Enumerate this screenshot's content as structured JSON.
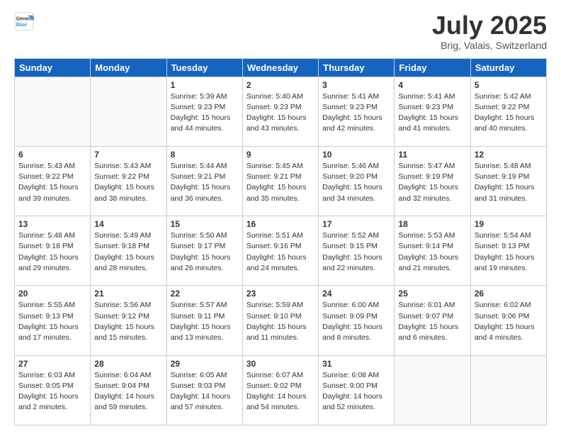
{
  "logo": {
    "general": "General",
    "blue": "Blue"
  },
  "header": {
    "title": "July 2025",
    "location": "Brig, Valais, Switzerland"
  },
  "weekdays": [
    "Sunday",
    "Monday",
    "Tuesday",
    "Wednesday",
    "Thursday",
    "Friday",
    "Saturday"
  ],
  "weeks": [
    [
      {
        "day": "",
        "sunrise": "",
        "sunset": "",
        "daylight": ""
      },
      {
        "day": "",
        "sunrise": "",
        "sunset": "",
        "daylight": ""
      },
      {
        "day": "1",
        "sunrise": "Sunrise: 5:39 AM",
        "sunset": "Sunset: 9:23 PM",
        "daylight": "Daylight: 15 hours and 44 minutes."
      },
      {
        "day": "2",
        "sunrise": "Sunrise: 5:40 AM",
        "sunset": "Sunset: 9:23 PM",
        "daylight": "Daylight: 15 hours and 43 minutes."
      },
      {
        "day": "3",
        "sunrise": "Sunrise: 5:41 AM",
        "sunset": "Sunset: 9:23 PM",
        "daylight": "Daylight: 15 hours and 42 minutes."
      },
      {
        "day": "4",
        "sunrise": "Sunrise: 5:41 AM",
        "sunset": "Sunset: 9:23 PM",
        "daylight": "Daylight: 15 hours and 41 minutes."
      },
      {
        "day": "5",
        "sunrise": "Sunrise: 5:42 AM",
        "sunset": "Sunset: 9:22 PM",
        "daylight": "Daylight: 15 hours and 40 minutes."
      }
    ],
    [
      {
        "day": "6",
        "sunrise": "Sunrise: 5:43 AM",
        "sunset": "Sunset: 9:22 PM",
        "daylight": "Daylight: 15 hours and 39 minutes."
      },
      {
        "day": "7",
        "sunrise": "Sunrise: 5:43 AM",
        "sunset": "Sunset: 9:22 PM",
        "daylight": "Daylight: 15 hours and 38 minutes."
      },
      {
        "day": "8",
        "sunrise": "Sunrise: 5:44 AM",
        "sunset": "Sunset: 9:21 PM",
        "daylight": "Daylight: 15 hours and 36 minutes."
      },
      {
        "day": "9",
        "sunrise": "Sunrise: 5:45 AM",
        "sunset": "Sunset: 9:21 PM",
        "daylight": "Daylight: 15 hours and 35 minutes."
      },
      {
        "day": "10",
        "sunrise": "Sunrise: 5:46 AM",
        "sunset": "Sunset: 9:20 PM",
        "daylight": "Daylight: 15 hours and 34 minutes."
      },
      {
        "day": "11",
        "sunrise": "Sunrise: 5:47 AM",
        "sunset": "Sunset: 9:19 PM",
        "daylight": "Daylight: 15 hours and 32 minutes."
      },
      {
        "day": "12",
        "sunrise": "Sunrise: 5:48 AM",
        "sunset": "Sunset: 9:19 PM",
        "daylight": "Daylight: 15 hours and 31 minutes."
      }
    ],
    [
      {
        "day": "13",
        "sunrise": "Sunrise: 5:48 AM",
        "sunset": "Sunset: 9:18 PM",
        "daylight": "Daylight: 15 hours and 29 minutes."
      },
      {
        "day": "14",
        "sunrise": "Sunrise: 5:49 AM",
        "sunset": "Sunset: 9:18 PM",
        "daylight": "Daylight: 15 hours and 28 minutes."
      },
      {
        "day": "15",
        "sunrise": "Sunrise: 5:50 AM",
        "sunset": "Sunset: 9:17 PM",
        "daylight": "Daylight: 15 hours and 26 minutes."
      },
      {
        "day": "16",
        "sunrise": "Sunrise: 5:51 AM",
        "sunset": "Sunset: 9:16 PM",
        "daylight": "Daylight: 15 hours and 24 minutes."
      },
      {
        "day": "17",
        "sunrise": "Sunrise: 5:52 AM",
        "sunset": "Sunset: 9:15 PM",
        "daylight": "Daylight: 15 hours and 22 minutes."
      },
      {
        "day": "18",
        "sunrise": "Sunrise: 5:53 AM",
        "sunset": "Sunset: 9:14 PM",
        "daylight": "Daylight: 15 hours and 21 minutes."
      },
      {
        "day": "19",
        "sunrise": "Sunrise: 5:54 AM",
        "sunset": "Sunset: 9:13 PM",
        "daylight": "Daylight: 15 hours and 19 minutes."
      }
    ],
    [
      {
        "day": "20",
        "sunrise": "Sunrise: 5:55 AM",
        "sunset": "Sunset: 9:13 PM",
        "daylight": "Daylight: 15 hours and 17 minutes."
      },
      {
        "day": "21",
        "sunrise": "Sunrise: 5:56 AM",
        "sunset": "Sunset: 9:12 PM",
        "daylight": "Daylight: 15 hours and 15 minutes."
      },
      {
        "day": "22",
        "sunrise": "Sunrise: 5:57 AM",
        "sunset": "Sunset: 9:11 PM",
        "daylight": "Daylight: 15 hours and 13 minutes."
      },
      {
        "day": "23",
        "sunrise": "Sunrise: 5:59 AM",
        "sunset": "Sunset: 9:10 PM",
        "daylight": "Daylight: 15 hours and 11 minutes."
      },
      {
        "day": "24",
        "sunrise": "Sunrise: 6:00 AM",
        "sunset": "Sunset: 9:09 PM",
        "daylight": "Daylight: 15 hours and 8 minutes."
      },
      {
        "day": "25",
        "sunrise": "Sunrise: 6:01 AM",
        "sunset": "Sunset: 9:07 PM",
        "daylight": "Daylight: 15 hours and 6 minutes."
      },
      {
        "day": "26",
        "sunrise": "Sunrise: 6:02 AM",
        "sunset": "Sunset: 9:06 PM",
        "daylight": "Daylight: 15 hours and 4 minutes."
      }
    ],
    [
      {
        "day": "27",
        "sunrise": "Sunrise: 6:03 AM",
        "sunset": "Sunset: 9:05 PM",
        "daylight": "Daylight: 15 hours and 2 minutes."
      },
      {
        "day": "28",
        "sunrise": "Sunrise: 6:04 AM",
        "sunset": "Sunset: 9:04 PM",
        "daylight": "Daylight: 14 hours and 59 minutes."
      },
      {
        "day": "29",
        "sunrise": "Sunrise: 6:05 AM",
        "sunset": "Sunset: 9:03 PM",
        "daylight": "Daylight: 14 hours and 57 minutes."
      },
      {
        "day": "30",
        "sunrise": "Sunrise: 6:07 AM",
        "sunset": "Sunset: 9:02 PM",
        "daylight": "Daylight: 14 hours and 54 minutes."
      },
      {
        "day": "31",
        "sunrise": "Sunrise: 6:08 AM",
        "sunset": "Sunset: 9:00 PM",
        "daylight": "Daylight: 14 hours and 52 minutes."
      },
      {
        "day": "",
        "sunrise": "",
        "sunset": "",
        "daylight": ""
      },
      {
        "day": "",
        "sunrise": "",
        "sunset": "",
        "daylight": ""
      }
    ]
  ]
}
